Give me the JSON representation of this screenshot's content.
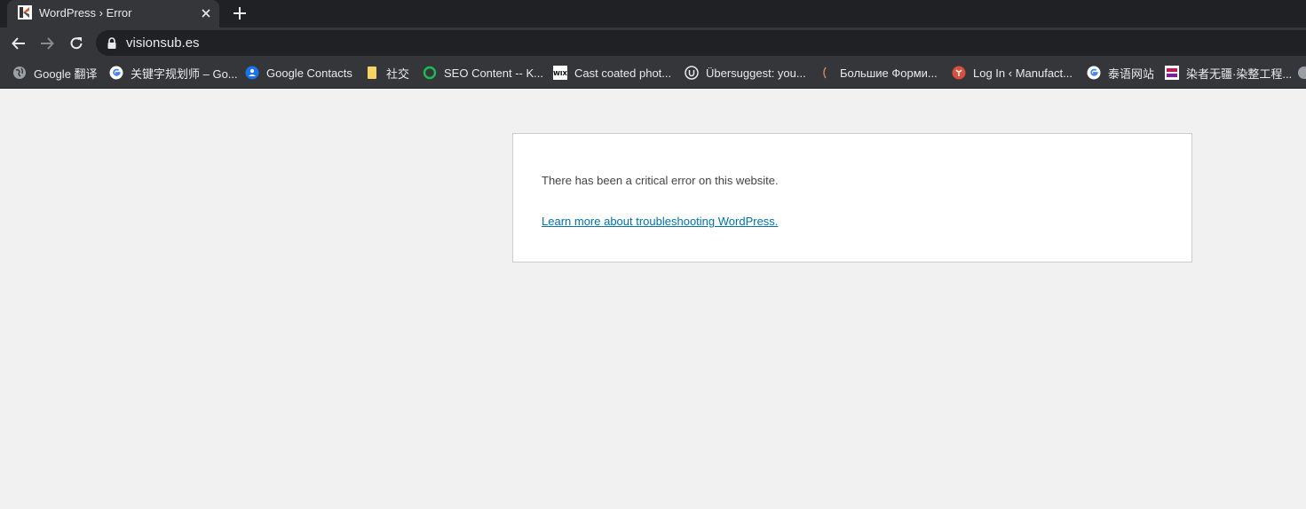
{
  "tab": {
    "title": "WordPress › Error",
    "favicon": "wordpress-k-icon"
  },
  "toolbar": {
    "url": "visionsub.es"
  },
  "bookmarks": [
    {
      "label": "Google 翻译",
      "icon": "globe-icon"
    },
    {
      "label": "关键字规划师 – Go...",
      "icon": "google-icon"
    },
    {
      "label": "Google Contacts",
      "icon": "contacts-icon"
    },
    {
      "label": "社交",
      "icon": "folder-icon"
    },
    {
      "label": "SEO Content -- K...",
      "icon": "ring-icon"
    },
    {
      "label": "Cast coated phot...",
      "icon": "wix-icon"
    },
    {
      "label": "Übersuggest: you...",
      "icon": "ubersuggest-icon"
    },
    {
      "label": "Большие Форми...",
      "icon": "paren-icon"
    },
    {
      "label": "Log In ‹ Manufact...",
      "icon": "login-icon"
    },
    {
      "label": "泰语网站",
      "icon": "google-icon"
    },
    {
      "label": "染者无疆·染整工程...",
      "icon": "site-icon"
    }
  ],
  "page": {
    "message": "There has been a critical error on this website.",
    "link": "Learn more about troubleshooting WordPress."
  },
  "colors": {
    "link": "#0073aa",
    "background": "#f1f1f1",
    "chrome_dark": "#202124",
    "chrome_mid": "#35363a"
  }
}
